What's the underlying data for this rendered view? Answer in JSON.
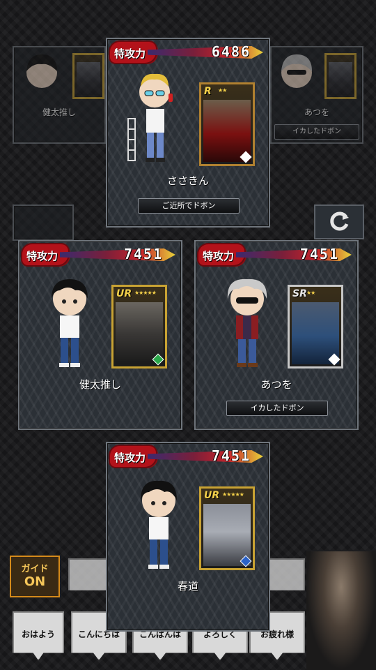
{
  "labels": {
    "tokkouryoku": "特攻力"
  },
  "background_slots": {
    "left": {
      "name": "健太推し"
    },
    "right": {
      "name": "あつを",
      "button": "イカしたドボン"
    }
  },
  "teams": [
    {
      "id": "top",
      "power": "6486",
      "name": "ささきん",
      "button": "ご近所でドボン",
      "card_rank": "R",
      "gem_color": "#ffffff"
    },
    {
      "id": "left",
      "power": "7451",
      "name": "健太推し",
      "button": "",
      "card_rank": "UR",
      "gem_color": "#2aa84a"
    },
    {
      "id": "right",
      "power": "7451",
      "name": "あつを",
      "button": "イカしたドボン",
      "card_rank": "SR",
      "gem_color": "#ffffff"
    },
    {
      "id": "bottom",
      "power": "7451",
      "name": "春道",
      "button": "",
      "card_rank": "UR",
      "gem_color": "#2a62c8"
    }
  ],
  "guide": {
    "label": "ガイド",
    "state": "ON"
  },
  "chat_bubbles": [
    "おはよう",
    "こんにちは",
    "こんばんは",
    "よろしく",
    "お疲れ様"
  ],
  "icons": {
    "reload": "refresh-icon"
  }
}
